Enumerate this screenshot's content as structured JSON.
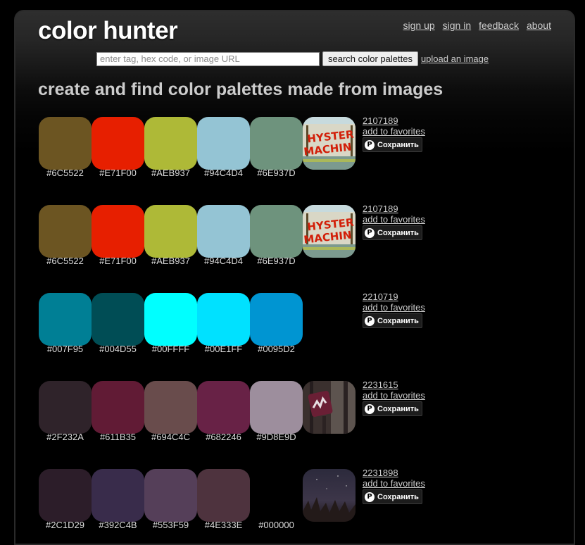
{
  "header": {
    "logo": "color hunter",
    "nav": [
      "sign up",
      "sign in",
      "feedback",
      "about"
    ]
  },
  "search": {
    "placeholder": "enter tag, hex code, or image URL",
    "value": "",
    "button_label": "search color palettes",
    "upload_label": "upload an image"
  },
  "headline": "create and find color palettes made from images",
  "palettes": [
    {
      "id": "2107189",
      "favorite_label": "add to favorites",
      "pin_label": "Сохранить",
      "thumbnail": "hysteria-machine-sign",
      "colors": [
        "#6C5522",
        "#E71F00",
        "#AEB937",
        "#94C4D4",
        "#6E937D"
      ],
      "thumb_text": "HYSTERIA MACHINE"
    },
    {
      "id": "2107189",
      "favorite_label": "add to favorites",
      "pin_label": "Сохранить",
      "thumbnail": "hysteria-machine-sign",
      "colors": [
        "#6C5522",
        "#E71F00",
        "#AEB937",
        "#94C4D4",
        "#6E937D"
      ],
      "thumb_text": "HYSTERIA MACHINE"
    },
    {
      "id": "2210719",
      "favorite_label": "add to favorites",
      "pin_label": "Сохранить",
      "thumbnail": "",
      "colors": [
        "#007F95",
        "#004D55",
        "#00FFFF",
        "#00E1FF",
        "#0095D2"
      ]
    },
    {
      "id": "2231615",
      "favorite_label": "add to favorites",
      "pin_label": "Сохранить",
      "thumbnail": "lightning-sign-in-woods",
      "colors": [
        "#2F232A",
        "#611B35",
        "#694C4C",
        "#682246",
        "#9D8E9D"
      ]
    },
    {
      "id": "2231898",
      "favorite_label": "add to favorites",
      "pin_label": "Сохранить",
      "thumbnail": "night-sky-grass",
      "colors": [
        "#2C1D29",
        "#392C4B",
        "#553F59",
        "#4E333E",
        "#000000"
      ]
    }
  ]
}
